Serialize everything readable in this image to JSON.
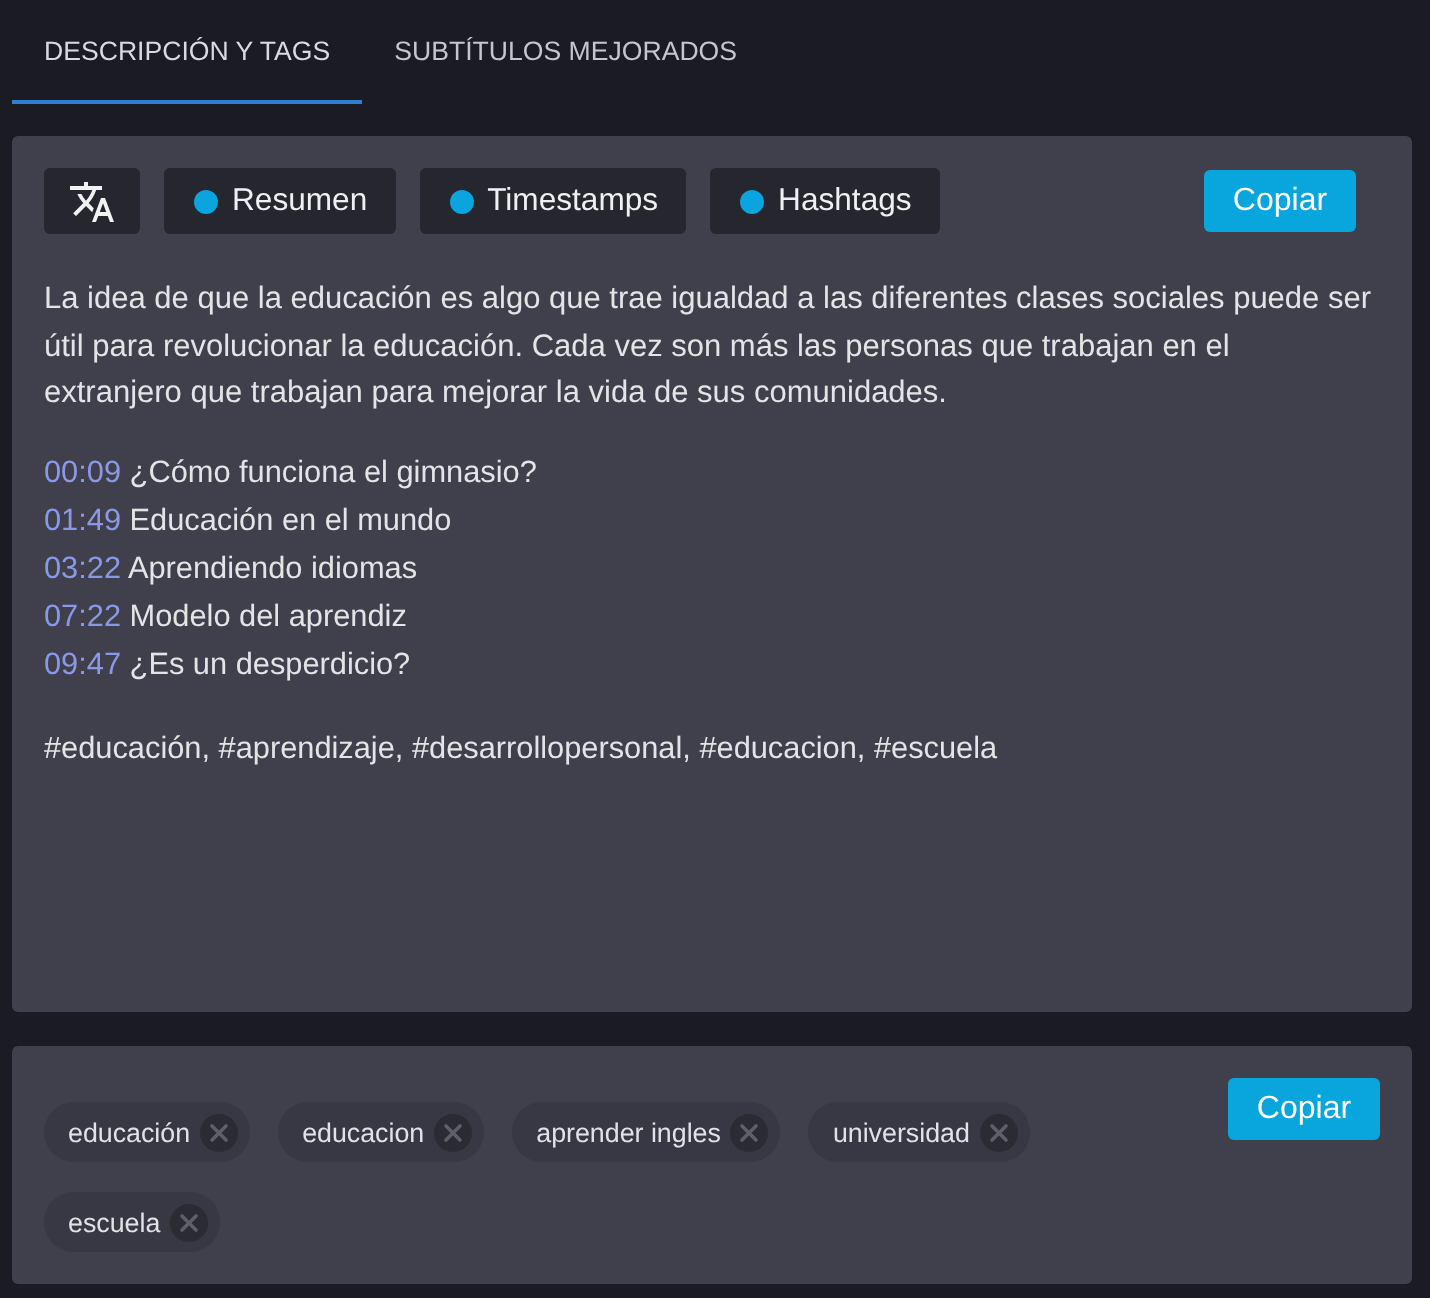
{
  "tabs": [
    {
      "label": "DESCRIPCIÓN Y TAGS",
      "selected": true
    },
    {
      "label": "SUBTÍTULOS MEJORADOS",
      "selected": false
    }
  ],
  "description_panel": {
    "toggles": [
      {
        "label": "Resumen",
        "on": true
      },
      {
        "label": "Timestamps",
        "on": true
      },
      {
        "label": "Hashtags",
        "on": true
      }
    ],
    "copy_button": "Copiar",
    "summary": "La idea de que la educación es algo que trae igualdad a las diferentes clases sociales puede ser útil para revolucionar la educación. Cada vez son más las personas que trabajan en el extranjero que trabajan para mejorar la vida de sus comunidades.",
    "timestamps": [
      {
        "time": "00:09",
        "title": "¿Cómo funciona el gimnasio?"
      },
      {
        "time": "01:49",
        "title": "Educación en el mundo"
      },
      {
        "time": "03:22",
        "title": "Aprendiendo idiomas"
      },
      {
        "time": "07:22",
        "title": "Modelo del aprendiz"
      },
      {
        "time": "09:47",
        "title": "¿Es un desperdicio?"
      }
    ],
    "hashtags": "#educación, #aprendizaje, #desarrollopersonal, #educacion, #escuela"
  },
  "tags_panel": {
    "tags": [
      "educación",
      "educacion",
      "aprender ingles",
      "universidad",
      "escuela"
    ],
    "copy_button": "Copiar"
  }
}
